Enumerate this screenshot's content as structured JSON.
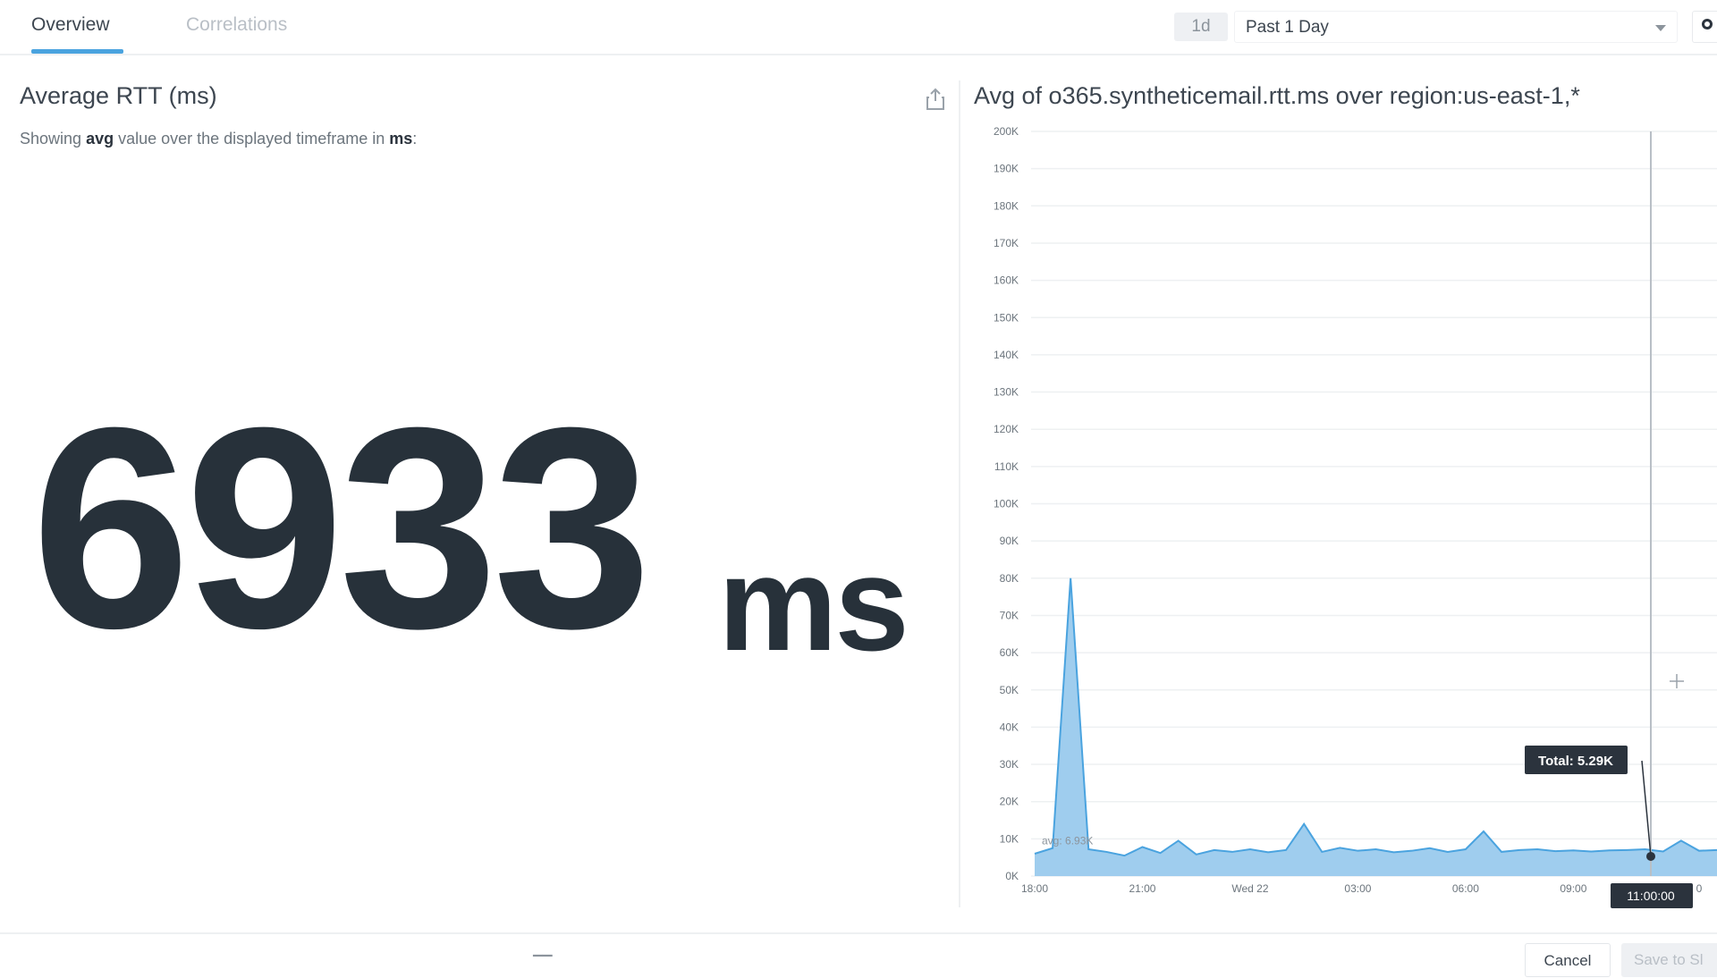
{
  "tabs": [
    {
      "label": "Overview",
      "active": true
    },
    {
      "label": "Correlations",
      "active": false
    }
  ],
  "timeframe": {
    "badge": "1d",
    "label": "Past 1 Day"
  },
  "left_panel": {
    "title": "Average RTT (ms)",
    "subtitle_prefix": "Showing ",
    "subtitle_agg": "avg",
    "subtitle_mid": " value over the displayed timeframe in ",
    "subtitle_unit": "ms",
    "subtitle_suffix": ":",
    "value": "6933",
    "unit": "ms"
  },
  "right_panel": {
    "title": "Avg of o365.syntheticemail.rtt.ms over region:us-east-1,*"
  },
  "footer": {
    "cancel_label": "Cancel",
    "save_label": "Save to Sl"
  },
  "colors": {
    "series": "#4aa3df",
    "series_fill": "#9fcdee",
    "text": "#27313a"
  },
  "chart_data": {
    "type": "area",
    "title": "Avg of o365.syntheticemail.rtt.ms over region:us-east-1,*",
    "ylim": [
      0,
      200000
    ],
    "yticks": [
      "0K",
      "10K",
      "20K",
      "30K",
      "40K",
      "50K",
      "60K",
      "70K",
      "80K",
      "90K",
      "100K",
      "110K",
      "120K",
      "130K",
      "140K",
      "150K",
      "160K",
      "170K",
      "180K",
      "190K",
      "200K"
    ],
    "xticks": [
      "18:00",
      "21:00",
      "Wed 22",
      "03:00",
      "06:00",
      "09:00"
    ],
    "x_range_hours": [
      0,
      19
    ],
    "series": [
      {
        "values_hours": [
          0.0,
          0.5,
          1.0,
          1.5,
          2.0,
          2.5,
          3.0,
          3.5,
          4.0,
          4.5,
          5.0,
          5.5,
          6.0,
          6.5,
          7.0,
          7.5,
          8.0,
          8.5,
          9.0,
          9.5,
          10.0,
          10.5,
          11.0,
          11.5,
          12.0,
          12.5,
          13.0,
          13.5,
          14.0,
          14.5,
          15.0,
          15.5,
          16.0,
          16.5,
          17.0,
          17.5,
          18.0,
          18.5,
          19.0
        ],
        "values": [
          6000,
          7500,
          80000,
          7200,
          6500,
          5500,
          7800,
          6200,
          9500,
          5800,
          7000,
          6500,
          7200,
          6400,
          7000,
          14000,
          6500,
          7600,
          6800,
          7200,
          6400,
          6800,
          7500,
          6500,
          7200,
          12000,
          6500,
          7000,
          7200,
          6700,
          6900,
          6600,
          6900,
          7000,
          7200,
          6600,
          9500,
          6800,
          7000
        ]
      }
    ],
    "avg_label": "avg: 6.93K",
    "tooltip": {
      "total": "Total: 5.29K",
      "time": "11:00:00"
    },
    "partial_tick": "0"
  }
}
